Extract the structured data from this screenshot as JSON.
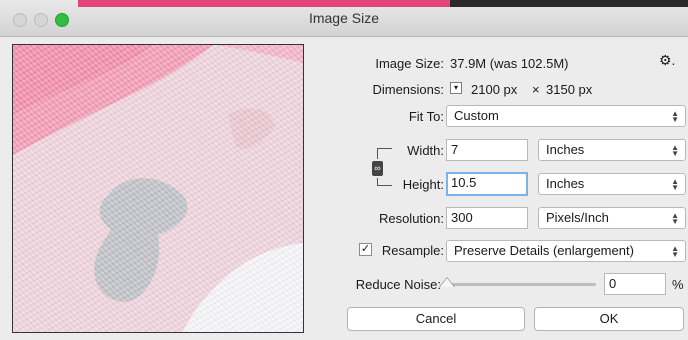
{
  "window": {
    "title": "Image Size"
  },
  "info": {
    "image_size_label": "Image Size:",
    "image_size_value": "37.9M (was 102.5M)",
    "dimensions_label": "Dimensions:",
    "dimensions_width": "2100 px",
    "dimensions_times": "×",
    "dimensions_height": "3150 px"
  },
  "fit_to": {
    "label": "Fit To:",
    "value": "Custom"
  },
  "width": {
    "label": "Width:",
    "value": "7",
    "unit": "Inches"
  },
  "height": {
    "label": "Height:",
    "value": "10.5",
    "unit": "Inches"
  },
  "resolution": {
    "label": "Resolution:",
    "value": "300",
    "unit": "Pixels/Inch"
  },
  "resample": {
    "label": "Resample:",
    "checked": true,
    "value": "Preserve Details (enlargement)"
  },
  "reduce_noise": {
    "label": "Reduce Noise:",
    "value": "0",
    "unit": "%",
    "level": 0
  },
  "buttons": {
    "cancel": "Cancel",
    "ok": "OK"
  },
  "icons": {
    "gear": "gear-icon",
    "link": "link-icon",
    "dimensions_menu": "dropdown-icon",
    "select_arrows": "updown-arrows-icon"
  },
  "colors": {
    "zoom_button": "#2fbe3f",
    "focus_ring": "#7ab2ec",
    "preview_pink": "#f2d7df"
  }
}
